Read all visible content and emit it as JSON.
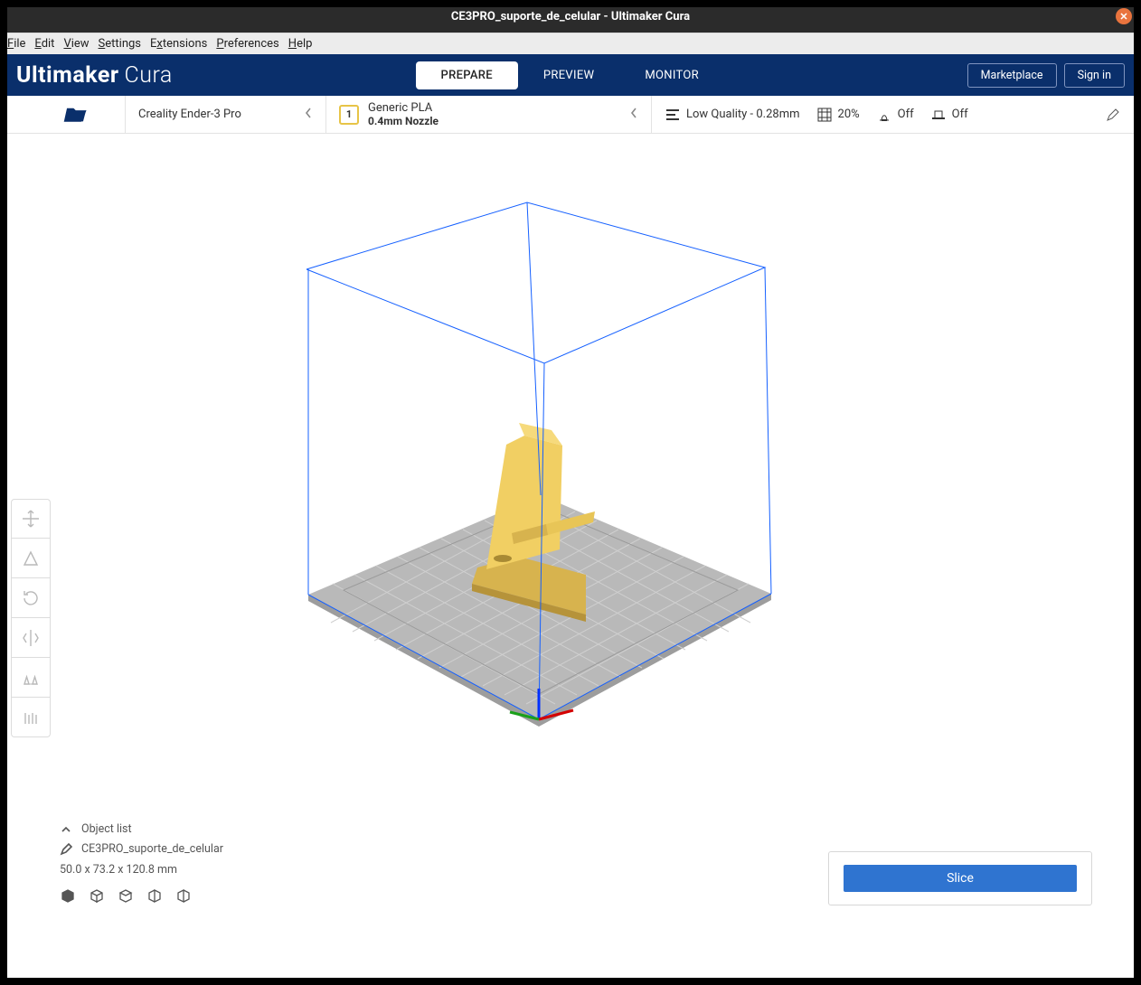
{
  "window": {
    "title": "CE3PRO_suporte_de_celular - Ultimaker Cura"
  },
  "menubar": [
    "File",
    "Edit",
    "View",
    "Settings",
    "Extensions",
    "Preferences",
    "Help"
  ],
  "brand": {
    "bold": "Ultimaker",
    "thin": "Cura"
  },
  "stages": {
    "prepare": "PREPARE",
    "preview": "PREVIEW",
    "monitor": "MONITOR"
  },
  "header_buttons": {
    "marketplace": "Marketplace",
    "signin": "Sign in"
  },
  "printer": {
    "name": "Creality Ender-3 Pro"
  },
  "material": {
    "extruder": "1",
    "name": "Generic PLA",
    "nozzle": "0.4mm Nozzle"
  },
  "print_settings": {
    "profile": "Low Quality - 0.28mm",
    "infill": "20%",
    "support": "Off",
    "adhesion": "Off"
  },
  "sidebar_tools": [
    "move-tool",
    "scale-tool",
    "rotate-tool",
    "mirror-tool",
    "mesh-tool",
    "support-tool"
  ],
  "object_list": {
    "header": "Object list",
    "name": "CE3PRO_suporte_de_celular",
    "dimensions": "50.0 x 73.2 x 120.8 mm"
  },
  "slice_button": "Slice"
}
